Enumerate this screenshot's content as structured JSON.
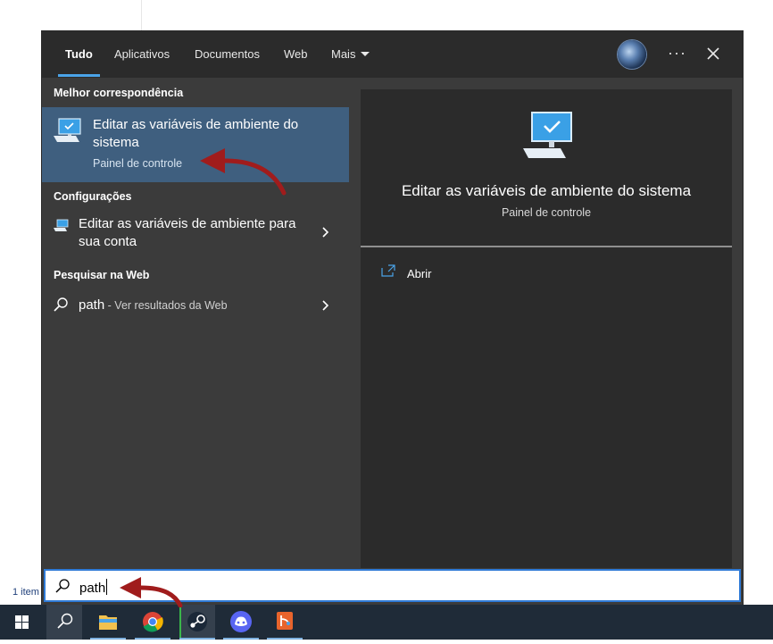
{
  "tabs": [
    {
      "label": "Tudo",
      "active": true
    },
    {
      "label": "Aplicativos"
    },
    {
      "label": "Documentos"
    },
    {
      "label": "Web"
    },
    {
      "label": "Mais"
    }
  ],
  "header": {
    "more_options": "···"
  },
  "sections": {
    "best_match": "Melhor correspondência",
    "settings": "Configurações",
    "web_search": "Pesquisar na Web"
  },
  "best_match": {
    "title": "Editar as variáveis de ambiente do sistema",
    "subtitle": "Painel de controle"
  },
  "settings_item": {
    "title": "Editar as variáveis de ambiente para sua conta"
  },
  "web_item": {
    "query": "path",
    "suffix": " - Ver resultados da Web"
  },
  "preview": {
    "title": "Editar as variáveis de ambiente do sistema",
    "subtitle": "Painel de controle",
    "open_label": "Abrir"
  },
  "search": {
    "value": "path"
  },
  "background": {
    "status": "1 item"
  },
  "taskbar": {
    "apps": [
      "start-icon",
      "search-icon",
      "file-explorer-icon",
      "chrome-icon",
      "steam-icon",
      "discord-icon",
      "git-tool-icon"
    ]
  },
  "colors": {
    "accent": "#4aa3e8",
    "selection": "#3f5f7f",
    "annotation_arrow": "#a01c1c"
  }
}
